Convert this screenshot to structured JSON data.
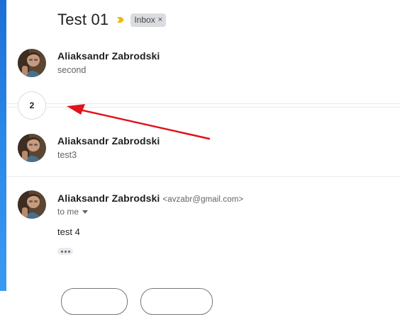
{
  "thread": {
    "subject": "Test 01",
    "label": "Inbox",
    "label_close": "×",
    "collapsed_count": "2"
  },
  "messages": [
    {
      "sender": "Aliaksandr Zabrodski",
      "snippet": "second"
    },
    {
      "sender": "Aliaksandr Zabrodski",
      "snippet": "test3"
    },
    {
      "sender": "Aliaksandr Zabrodski",
      "email": "<avzabr@gmail.com>",
      "recipient": "to me",
      "body": "test 4"
    }
  ],
  "icons": {
    "importance": "importance-marker-icon",
    "recipient_caret": "chevron-down-icon",
    "show_trimmed": "ellipsis-icon"
  },
  "colors": {
    "importance_marker": "#f2b600",
    "label_chip_bg": "#dadce0",
    "annotation_arrow": "#e0141b",
    "left_strip": "#2a86e8"
  }
}
